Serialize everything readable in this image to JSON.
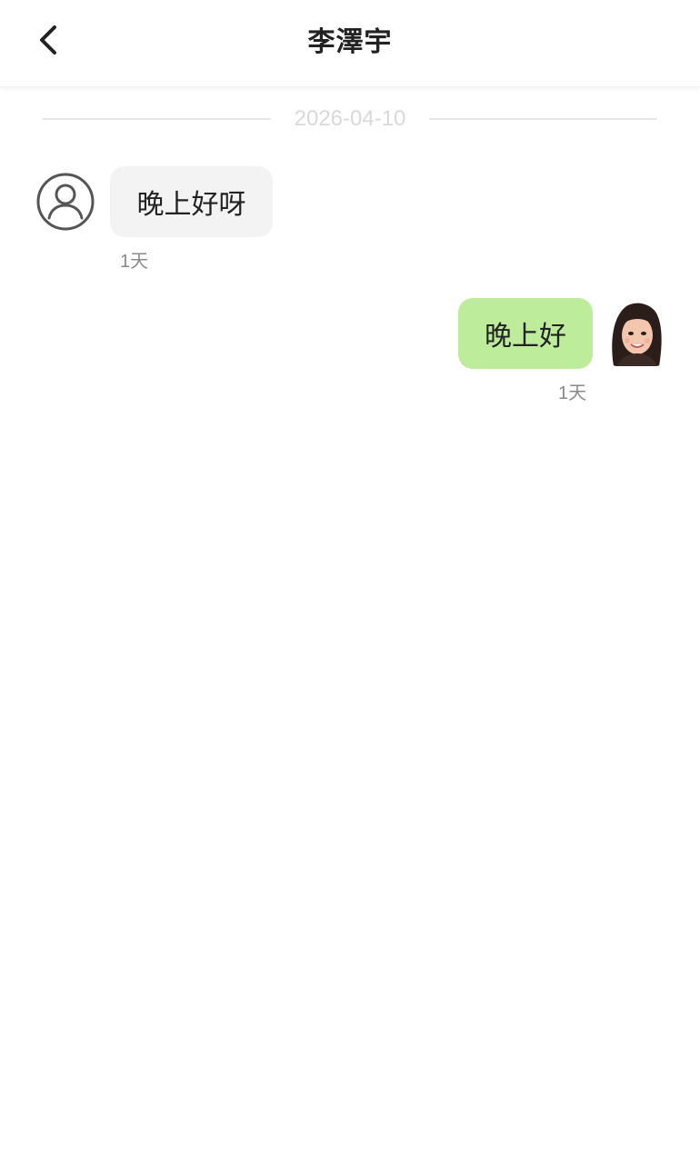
{
  "header": {
    "title": "李澤宇",
    "back_icon": "chevron-left-icon"
  },
  "conversation": {
    "date": "2026-04-10",
    "messages": [
      {
        "direction": "received",
        "text": "晚上好呀",
        "time": "1天",
        "avatar_icon": "user-outline-icon"
      },
      {
        "direction": "sent",
        "text": "晚上好",
        "time": "1天",
        "avatar": "user-photo"
      }
    ]
  },
  "colors": {
    "sent_bubble": "#bdec9b",
    "received_bubble": "#f3f3f3",
    "title_text": "#222222",
    "meta_text": "#8a8a8a"
  }
}
